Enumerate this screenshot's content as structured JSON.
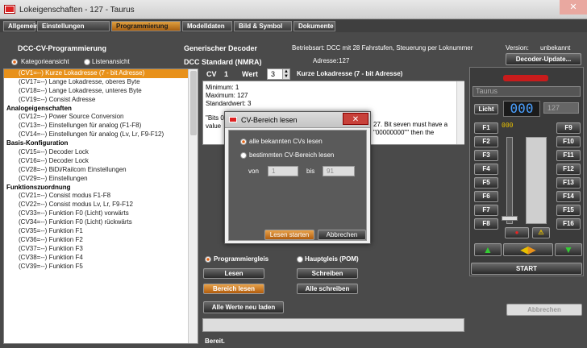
{
  "window": {
    "title": "Lokeigenschaften - 127 - Taurus",
    "close": "✕"
  },
  "tabs": [
    "Allgemein",
    "Einstellungen",
    "Programmierung",
    "Modelldaten",
    "Bild & Symbol",
    "Dokumente"
  ],
  "left": {
    "header": "DCC-CV-Programmierung",
    "view_category": "Kategorieansicht",
    "view_list": "Listenansicht",
    "items": [
      {
        "text": "(CV1=--) Kurze Lokadresse (7 - bit Adresse)",
        "type": "sel"
      },
      {
        "text": "(CV17=--) Lange Lokadresse, oberes Byte",
        "type": "item"
      },
      {
        "text": "(CV18=--) Lange Lokadresse, unteres Byte",
        "type": "item"
      },
      {
        "text": "(CV19=--) Consist Adresse",
        "type": "item"
      },
      {
        "text": "Analogeigenschaften",
        "type": "grp"
      },
      {
        "text": "(CV12=--) Power Source Conversion",
        "type": "item"
      },
      {
        "text": "(CV13=--) Einstellungen für analog (F1-F8)",
        "type": "item"
      },
      {
        "text": "(CV14=--) Einstellungen für analog (Lv, Lr, F9-F12)",
        "type": "item"
      },
      {
        "text": "Basis-Konfiguration",
        "type": "grp"
      },
      {
        "text": "(CV15=--) Decoder Lock",
        "type": "item"
      },
      {
        "text": "(CV16=--) Decoder Lock",
        "type": "item"
      },
      {
        "text": "(CV28=--) BiDi/Railcom Einstellungen",
        "type": "item"
      },
      {
        "text": "(CV29=--) Einstellungen",
        "type": "item"
      },
      {
        "text": "Funktionszuordnung",
        "type": "grp"
      },
      {
        "text": "(CV21=--) Consist modus F1-F8",
        "type": "item"
      },
      {
        "text": "(CV22=--) Consist modus Lv, Lr, F9-F12",
        "type": "item"
      },
      {
        "text": "(CV33=--) Funktion F0 (Licht) vorwärts",
        "type": "item"
      },
      {
        "text": "(CV34=--) Funktion F0 (Licht) rückwärts",
        "type": "item"
      },
      {
        "text": "(CV35=--) Funktion F1",
        "type": "item"
      },
      {
        "text": "(CV36=--) Funktion F2",
        "type": "item"
      },
      {
        "text": "(CV37=--) Funktion F3",
        "type": "item"
      },
      {
        "text": "(CV38=--) Funktion F4",
        "type": "item"
      },
      {
        "text": "(CV39=--) Funktion F5",
        "type": "item"
      }
    ]
  },
  "center": {
    "decoder": "Generischer Decoder",
    "standard": "DCC Standard (NMRA)",
    "cv_label": "CV",
    "cv_num": "1",
    "wert_label": "Wert",
    "wert_val": "3",
    "cv_desc": "Kurze Lokadresse (7 - bit Adresse)",
    "info_lines": [
      "Minimum: 1",
      "Maximum: 127",
      "Standardwert: 3",
      "",
      "\"Bits 0",
      "value"
    ],
    "info_right_1": "27. Bit seven must have a",
    "info_right_2": "\"00000000\"\" then the",
    "prog_track": "Programmiergleis",
    "main_track": "Hauptgleis (POM)",
    "btn_read": "Lesen",
    "btn_write": "Schreiben",
    "btn_read_range": "Bereich lesen",
    "btn_write_all": "Alle schreiben",
    "btn_reload_all": "Alle Werte neu laden",
    "status": "Bereit."
  },
  "info": {
    "mode_label": "Betriebsart:",
    "mode_value": "DCC mit 28 Fahrstufen, Steuerung per Loknummer",
    "version_label": "Version:",
    "version_value": "unbekannt",
    "address_label": "Adresse:",
    "address_value": "127",
    "decoder_update": "Decoder-Update..."
  },
  "cab": {
    "name": "Taurus",
    "light": "Licht",
    "speed": "000",
    "address": "127",
    "step": "000",
    "f_left": [
      "F1",
      "F2",
      "F3",
      "F4",
      "F5",
      "F6",
      "F7",
      "F8"
    ],
    "f_right": [
      "F9",
      "F10",
      "F11",
      "F12",
      "F13",
      "F14",
      "F15",
      "F16"
    ],
    "start": "START",
    "cancel": "Abbrechen"
  },
  "dialog": {
    "title": "CV-Bereich lesen",
    "opt_all": "alle bekannten CVs lesen",
    "opt_range": "bestimmten CV-Bereich lesen",
    "from_label": "von",
    "from_val": "1",
    "to_label": "bis",
    "to_val": "91",
    "btn_start": "Lesen starten",
    "btn_cancel": "Abbrechen"
  },
  "colors": {
    "accent": "#e8911a",
    "panel": "#4a4a4a"
  }
}
